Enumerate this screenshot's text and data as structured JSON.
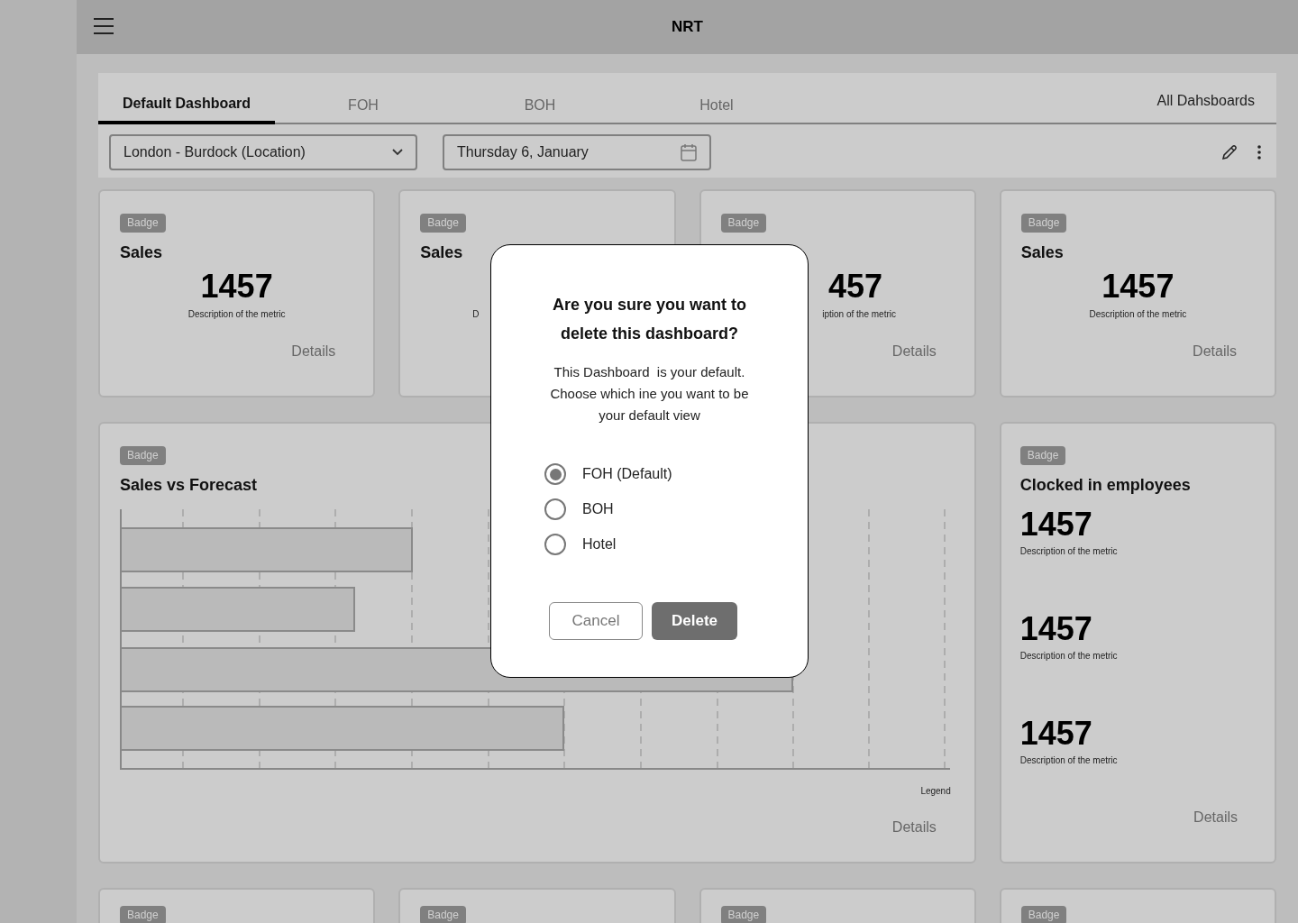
{
  "app_bar": {
    "title": "NRT"
  },
  "tabs": [
    {
      "label": "Default Dashboard",
      "selected": true
    },
    {
      "label": "FOH",
      "selected": false
    },
    {
      "label": "BOH",
      "selected": false
    },
    {
      "label": "Hotel",
      "selected": false
    }
  ],
  "all_dashboards_link": "All Dahsboards",
  "location_select": {
    "value": "London - Burdock (Location)"
  },
  "date_field": {
    "value": "Thursday 6, January"
  },
  "metric_cards": [
    {
      "badge": "Badge",
      "title": "Sales",
      "value": "1457",
      "description": "Description of the metric",
      "details": "Details"
    },
    {
      "badge": "Badge",
      "title": "Sales",
      "description": "D"
    },
    {
      "badge": "Badge",
      "value": "457",
      "description": "iption of the metric",
      "details": "Details"
    },
    {
      "badge": "Badge",
      "title": "Sales",
      "value": "1457",
      "description": "Description of the metric",
      "details": "Details"
    }
  ],
  "chart_card": {
    "badge": "Badge",
    "title": "Sales vs Forecast",
    "legend": "Legend",
    "details": "Details"
  },
  "employees_card": {
    "badge": "Badge",
    "title": "Clocked in employees",
    "metrics": [
      {
        "value": "1457",
        "description": "Description of the metric"
      },
      {
        "value": "1457",
        "description": "Description of the metric"
      },
      {
        "value": "1457",
        "description": "Description of the metric"
      }
    ],
    "details": "Details"
  },
  "bottom_cards": [
    {
      "badge": "Badge"
    },
    {
      "badge": "Badge"
    },
    {
      "badge": "Badge"
    },
    {
      "badge": "Badge"
    }
  ],
  "dialog": {
    "title": "Are you sure you want to delete this dashboard?",
    "message": "This Dashboard  is your default. Choose which ine you want to be your default view",
    "options": [
      {
        "label": "FOH (Default)",
        "selected": true
      },
      {
        "label": "BOH",
        "selected": false
      },
      {
        "label": "Hotel",
        "selected": false
      }
    ],
    "cancel": "Cancel",
    "delete": "Delete"
  }
}
